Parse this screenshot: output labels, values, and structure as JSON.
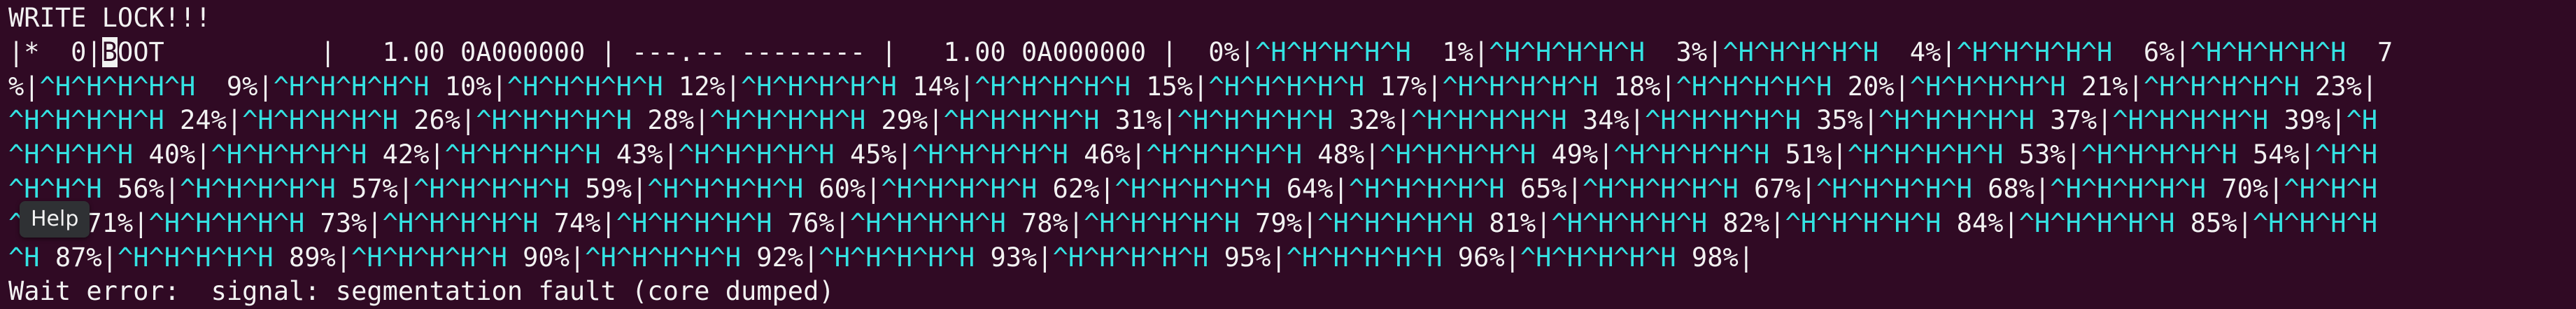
{
  "theme": {
    "background": "#300a24",
    "foreground": "#f2f2f2",
    "control_char_color": "#34e2e2",
    "tooltip_background": "#2f3134"
  },
  "terminal": {
    "lines": [
      [
        {
          "t": "WRITE LOCK!!!",
          "c": false
        }
      ],
      [
        {
          "t": "|*  0|",
          "c": false
        },
        {
          "t": "B",
          "cursor": true
        },
        {
          "t": "OOT          |   1.00 0A000000 | ---.-- -------- |   1.00 0A000000 |  0%|",
          "c": false
        },
        {
          "t": "^H^H^H^H^H",
          "c": true
        },
        {
          "t": "  1%|",
          "c": false
        },
        {
          "t": "^H^H^H^H^H",
          "c": true
        },
        {
          "t": "  3%|",
          "c": false
        },
        {
          "t": "^H^H^H^H^H",
          "c": true
        },
        {
          "t": "  4%|",
          "c": false
        },
        {
          "t": "^H^H^H^H^H",
          "c": true
        },
        {
          "t": "  6%|",
          "c": false
        },
        {
          "t": "^H^H^H^H^H",
          "c": true
        },
        {
          "t": "  7",
          "c": false
        }
      ],
      [
        {
          "t": "%|",
          "c": false
        },
        {
          "t": "^H^H^H^H^H",
          "c": true
        },
        {
          "t": "  9%|",
          "c": false
        },
        {
          "t": "^H^H^H^H^H",
          "c": true
        },
        {
          "t": " 10%|",
          "c": false
        },
        {
          "t": "^H^H^H^H^H",
          "c": true
        },
        {
          "t": " 12%|",
          "c": false
        },
        {
          "t": "^H^H^H^H^H",
          "c": true
        },
        {
          "t": " 14%|",
          "c": false
        },
        {
          "t": "^H^H^H^H^H",
          "c": true
        },
        {
          "t": " 15%|",
          "c": false
        },
        {
          "t": "^H^H^H^H^H",
          "c": true
        },
        {
          "t": " 17%|",
          "c": false
        },
        {
          "t": "^H^H^H^H^H",
          "c": true
        },
        {
          "t": " 18%|",
          "c": false
        },
        {
          "t": "^H^H^H^H^H",
          "c": true
        },
        {
          "t": " 20%|",
          "c": false
        },
        {
          "t": "^H^H^H^H^H",
          "c": true
        },
        {
          "t": " 21%|",
          "c": false
        },
        {
          "t": "^H^H^H^H^H",
          "c": true
        },
        {
          "t": " 23%|",
          "c": false
        }
      ],
      [
        {
          "t": "^H^H^H^H^H",
          "c": true
        },
        {
          "t": " 24%|",
          "c": false
        },
        {
          "t": "^H^H^H^H^H",
          "c": true
        },
        {
          "t": " 26%|",
          "c": false
        },
        {
          "t": "^H^H^H^H^H",
          "c": true
        },
        {
          "t": " 28%|",
          "c": false
        },
        {
          "t": "^H^H^H^H^H",
          "c": true
        },
        {
          "t": " 29%|",
          "c": false
        },
        {
          "t": "^H^H^H^H^H",
          "c": true
        },
        {
          "t": " 31%|",
          "c": false
        },
        {
          "t": "^H^H^H^H^H",
          "c": true
        },
        {
          "t": " 32%|",
          "c": false
        },
        {
          "t": "^H^H^H^H^H",
          "c": true
        },
        {
          "t": " 34%|",
          "c": false
        },
        {
          "t": "^H^H^H^H^H",
          "c": true
        },
        {
          "t": " 35%|",
          "c": false
        },
        {
          "t": "^H^H^H^H^H",
          "c": true
        },
        {
          "t": " 37%|",
          "c": false
        },
        {
          "t": "^H^H^H^H^H",
          "c": true
        },
        {
          "t": " 39%|",
          "c": false
        },
        {
          "t": "^H",
          "c": true
        }
      ],
      [
        {
          "t": "^H^H^H^H",
          "c": true
        },
        {
          "t": " 40%|",
          "c": false
        },
        {
          "t": "^H^H^H^H^H",
          "c": true
        },
        {
          "t": " 42%|",
          "c": false
        },
        {
          "t": "^H^H^H^H^H",
          "c": true
        },
        {
          "t": " 43%|",
          "c": false
        },
        {
          "t": "^H^H^H^H^H",
          "c": true
        },
        {
          "t": " 45%|",
          "c": false
        },
        {
          "t": "^H^H^H^H^H",
          "c": true
        },
        {
          "t": " 46%|",
          "c": false
        },
        {
          "t": "^H^H^H^H^H",
          "c": true
        },
        {
          "t": " 48%|",
          "c": false
        },
        {
          "t": "^H^H^H^H^H",
          "c": true
        },
        {
          "t": " 49%|",
          "c": false
        },
        {
          "t": "^H^H^H^H^H",
          "c": true
        },
        {
          "t": " 51%|",
          "c": false
        },
        {
          "t": "^H^H^H^H^H",
          "c": true
        },
        {
          "t": " 53%|",
          "c": false
        },
        {
          "t": "^H^H^H^H^H",
          "c": true
        },
        {
          "t": " 54%|",
          "c": false
        },
        {
          "t": "^H^H",
          "c": true
        }
      ],
      [
        {
          "t": "^H^H^H",
          "c": true
        },
        {
          "t": " 56%|",
          "c": false
        },
        {
          "t": "^H^H^H^H^H",
          "c": true
        },
        {
          "t": " 57%|",
          "c": false
        },
        {
          "t": "^H^H^H^H^H",
          "c": true
        },
        {
          "t": " 59%|",
          "c": false
        },
        {
          "t": "^H^H^H^H^H",
          "c": true
        },
        {
          "t": " 60%|",
          "c": false
        },
        {
          "t": "^H^H^H^H^H",
          "c": true
        },
        {
          "t": " 62%|",
          "c": false
        },
        {
          "t": "^H^H^H^H^H",
          "c": true
        },
        {
          "t": " 64%|",
          "c": false
        },
        {
          "t": "^H^H^H^H^H",
          "c": true
        },
        {
          "t": " 65%|",
          "c": false
        },
        {
          "t": "^H^H^H^H^H",
          "c": true
        },
        {
          "t": " 67%|",
          "c": false
        },
        {
          "t": "^H^H^H^H^H",
          "c": true
        },
        {
          "t": " 68%|",
          "c": false
        },
        {
          "t": "^H^H^H^H^H",
          "c": true
        },
        {
          "t": " 70%|",
          "c": false
        },
        {
          "t": "^H^H^H",
          "c": true
        }
      ],
      [
        {
          "t": "^H^H",
          "c": true
        },
        {
          "t": " 71%|",
          "c": false
        },
        {
          "t": "^H^H^H^H^H",
          "c": true
        },
        {
          "t": " 73%|",
          "c": false
        },
        {
          "t": "^H^H^H^H^H",
          "c": true
        },
        {
          "t": " 74%|",
          "c": false
        },
        {
          "t": "^H^H^H^H^H",
          "c": true
        },
        {
          "t": " 76%|",
          "c": false
        },
        {
          "t": "^H^H^H^H^H",
          "c": true
        },
        {
          "t": " 78%|",
          "c": false
        },
        {
          "t": "^H^H^H^H^H",
          "c": true
        },
        {
          "t": " 79%|",
          "c": false
        },
        {
          "t": "^H^H^H^H^H",
          "c": true
        },
        {
          "t": " 81%|",
          "c": false
        },
        {
          "t": "^H^H^H^H^H",
          "c": true
        },
        {
          "t": " 82%|",
          "c": false
        },
        {
          "t": "^H^H^H^H^H",
          "c": true
        },
        {
          "t": " 84%|",
          "c": false
        },
        {
          "t": "^H^H^H^H^H",
          "c": true
        },
        {
          "t": " 85%|",
          "c": false
        },
        {
          "t": "^H^H^H^H",
          "c": true
        }
      ],
      [
        {
          "t": "^H",
          "c": true
        },
        {
          "t": " 87%|",
          "c": false
        },
        {
          "t": "^H^H^H^H^H",
          "c": true
        },
        {
          "t": " 89%|",
          "c": false
        },
        {
          "t": "^H^H^H^H^H",
          "c": true
        },
        {
          "t": " 90%|",
          "c": false
        },
        {
          "t": "^H^H^H^H^H",
          "c": true
        },
        {
          "t": " 92%|",
          "c": false
        },
        {
          "t": "^H^H^H^H^H",
          "c": true
        },
        {
          "t": " 93%|",
          "c": false
        },
        {
          "t": "^H^H^H^H^H",
          "c": true
        },
        {
          "t": " 95%|",
          "c": false
        },
        {
          "t": "^H^H^H^H^H",
          "c": true
        },
        {
          "t": " 96%|",
          "c": false
        },
        {
          "t": "^H^H^H^H^H",
          "c": true
        },
        {
          "t": " 98%|",
          "c": false
        }
      ],
      [
        {
          "t": "Wait error:  signal: segmentation fault (core dumped)",
          "c": false
        }
      ]
    ]
  },
  "tooltip": {
    "label": "Help"
  }
}
